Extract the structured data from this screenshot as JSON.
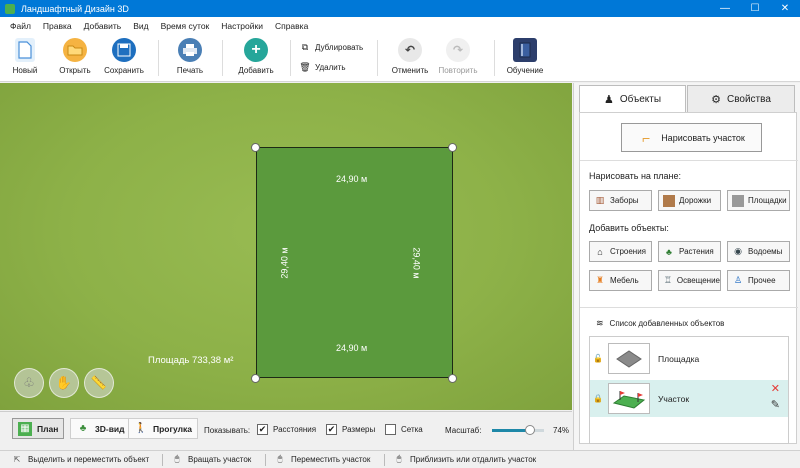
{
  "window": {
    "title": "Ландшафтный Дизайн 3D",
    "min": "—",
    "max": "☐",
    "close": "✕"
  },
  "menu": [
    "Файл",
    "Правка",
    "Добавить",
    "Вид",
    "Время суток",
    "Настройки",
    "Справка"
  ],
  "toolbar": {
    "new": "Новый",
    "open": "Открыть",
    "save": "Сохранить",
    "print": "Печать",
    "add": "Добавить",
    "duplicate": "Дублировать",
    "delete": "Удалить",
    "undo": "Отменить",
    "redo": "Повторить",
    "tutorial": "Обучение"
  },
  "canvas": {
    "top_dim": "24,90 м",
    "bottom_dim": "24,90 м",
    "left_dim": "29,40 м",
    "right_dim": "29,40 м",
    "area": "Площадь 733,38 м²"
  },
  "viewbar": {
    "tabs": [
      "План",
      "3D-вид",
      "Прогулка"
    ],
    "active_tab": "План",
    "show_label": "Показывать:",
    "distances": {
      "label": "Расстояния",
      "checked": true
    },
    "sizes": {
      "label": "Размеры",
      "checked": true
    },
    "grid": {
      "label": "Сетка",
      "checked": false
    },
    "scale_label": "Масштаб:",
    "scale_percent": "74%",
    "scale_value": 0.74
  },
  "status": [
    "Выделить и переместить объект",
    "Вращать участок",
    "Переместить участок",
    "Приблизить или отдалить участок"
  ],
  "panel": {
    "tab_objects": "Объекты",
    "tab_properties": "Свойства",
    "draw_plot": "Нарисовать участок",
    "draw_on_plan": "Нарисовать на плане:",
    "draw_buttons": [
      "Заборы",
      "Дорожки",
      "Площадки"
    ],
    "add_objects": "Добавить объекты:",
    "add_buttons": [
      "Строения",
      "Растения",
      "Водоемы",
      "Мебель",
      "Освещение",
      "Прочее"
    ],
    "list_title": "Список добавленных объектов",
    "list_items": [
      {
        "name": "Площадка",
        "selected": false
      },
      {
        "name": "Участок",
        "selected": true
      }
    ]
  },
  "colors": {
    "accent": "#0078d7",
    "plot": "#5b9a3d",
    "grass": "#8db148",
    "selected_row": "#d9f0ee"
  }
}
